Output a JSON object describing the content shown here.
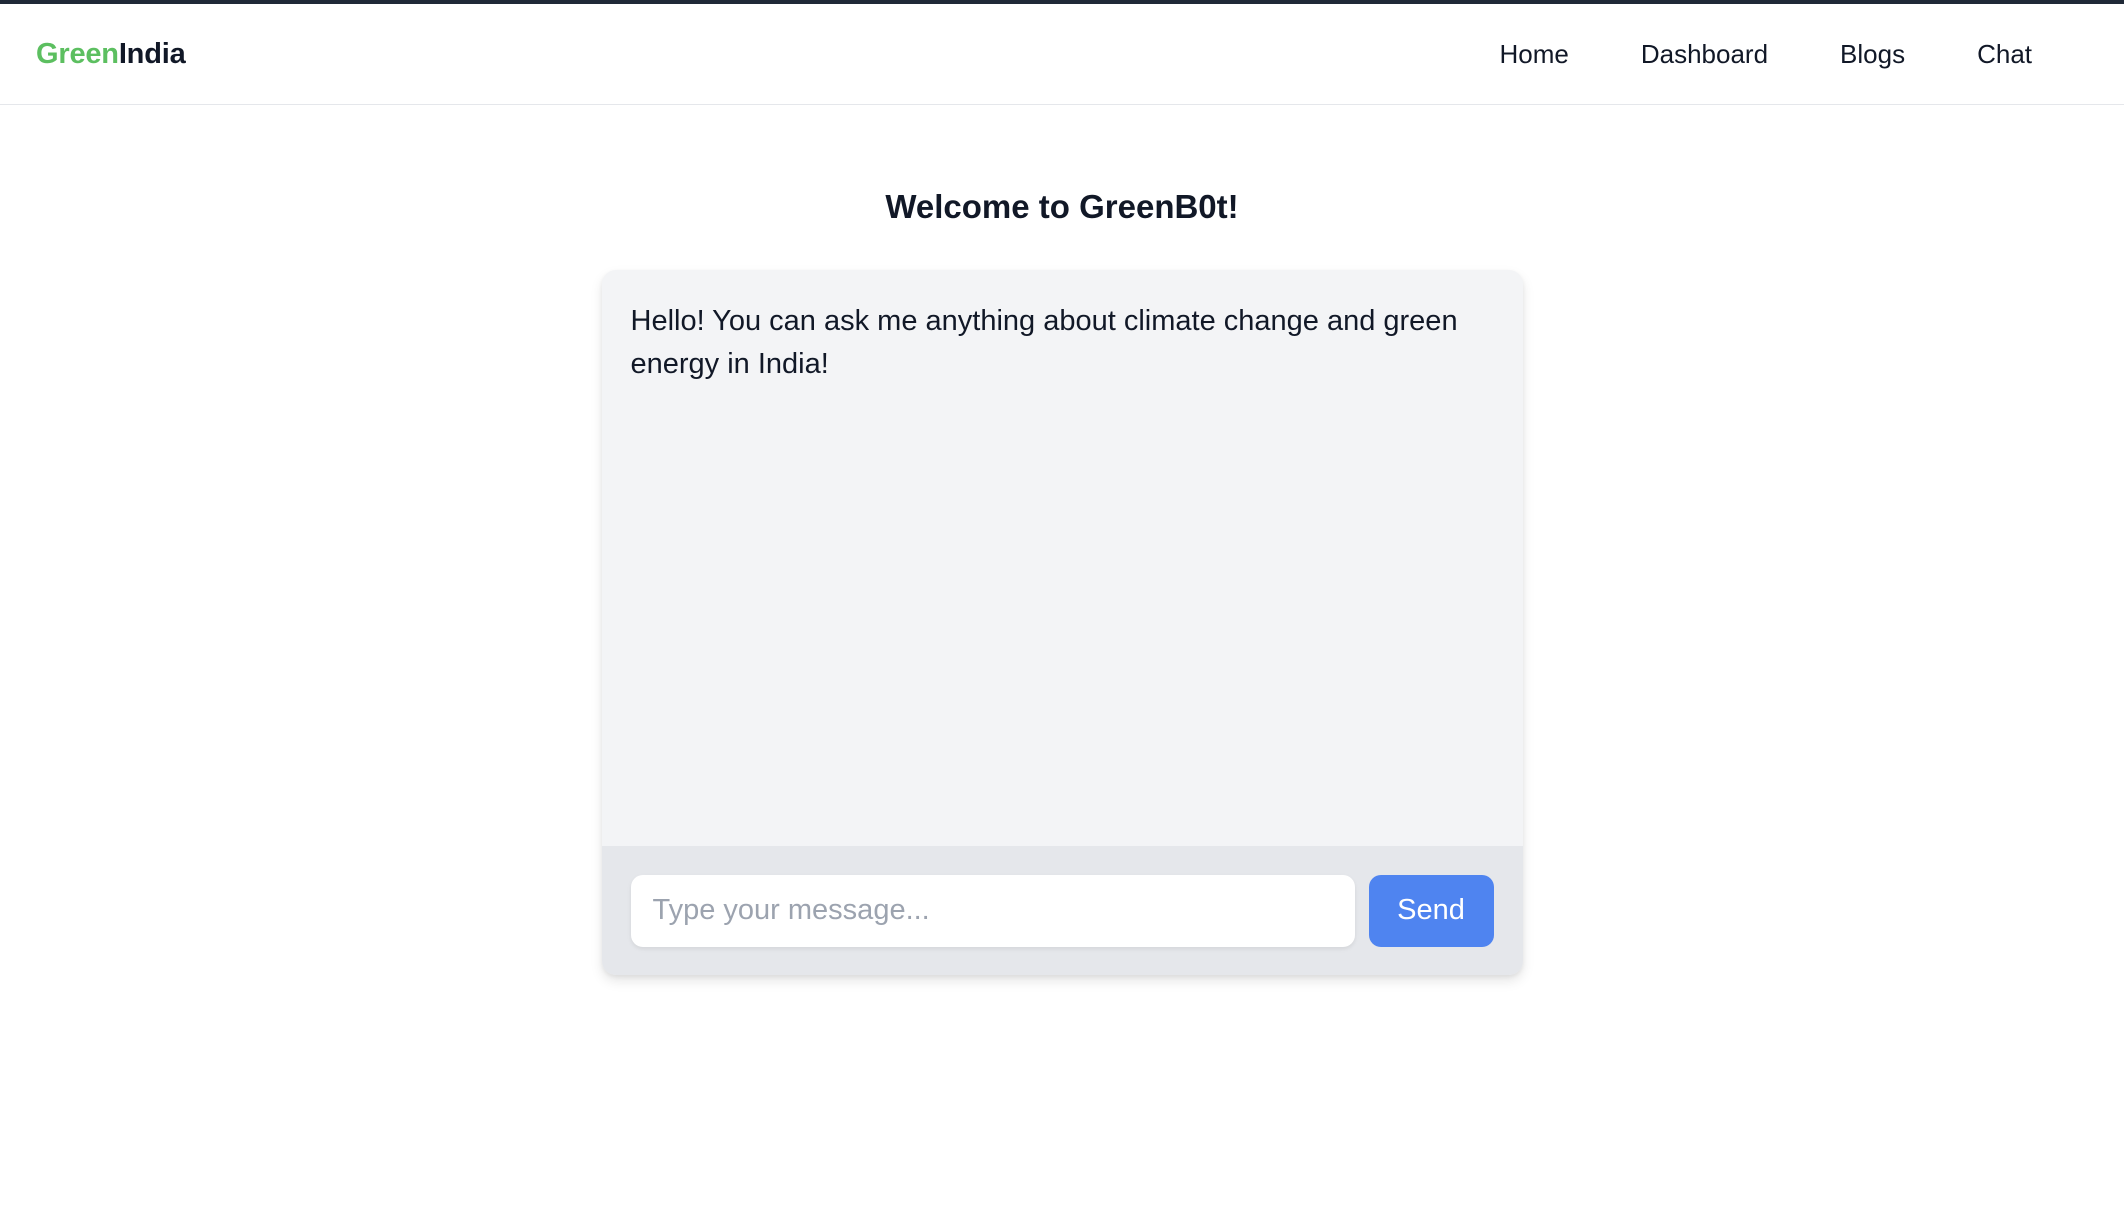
{
  "brand": {
    "logo_part1": "Green",
    "logo_part2": "India",
    "accent_color": "#5cbf60"
  },
  "nav": {
    "items": [
      {
        "label": "Home"
      },
      {
        "label": "Dashboard"
      },
      {
        "label": "Blogs"
      },
      {
        "label": "Chat"
      }
    ]
  },
  "page": {
    "title": "Welcome to GreenB0t!"
  },
  "chat": {
    "messages": [
      {
        "sender": "bot",
        "text": "Hello! You can ask me anything about climate change and green energy in India!"
      }
    ],
    "input": {
      "value": "",
      "placeholder": "Type your message..."
    },
    "send_label": "Send",
    "send_color": "#4f84f0"
  }
}
